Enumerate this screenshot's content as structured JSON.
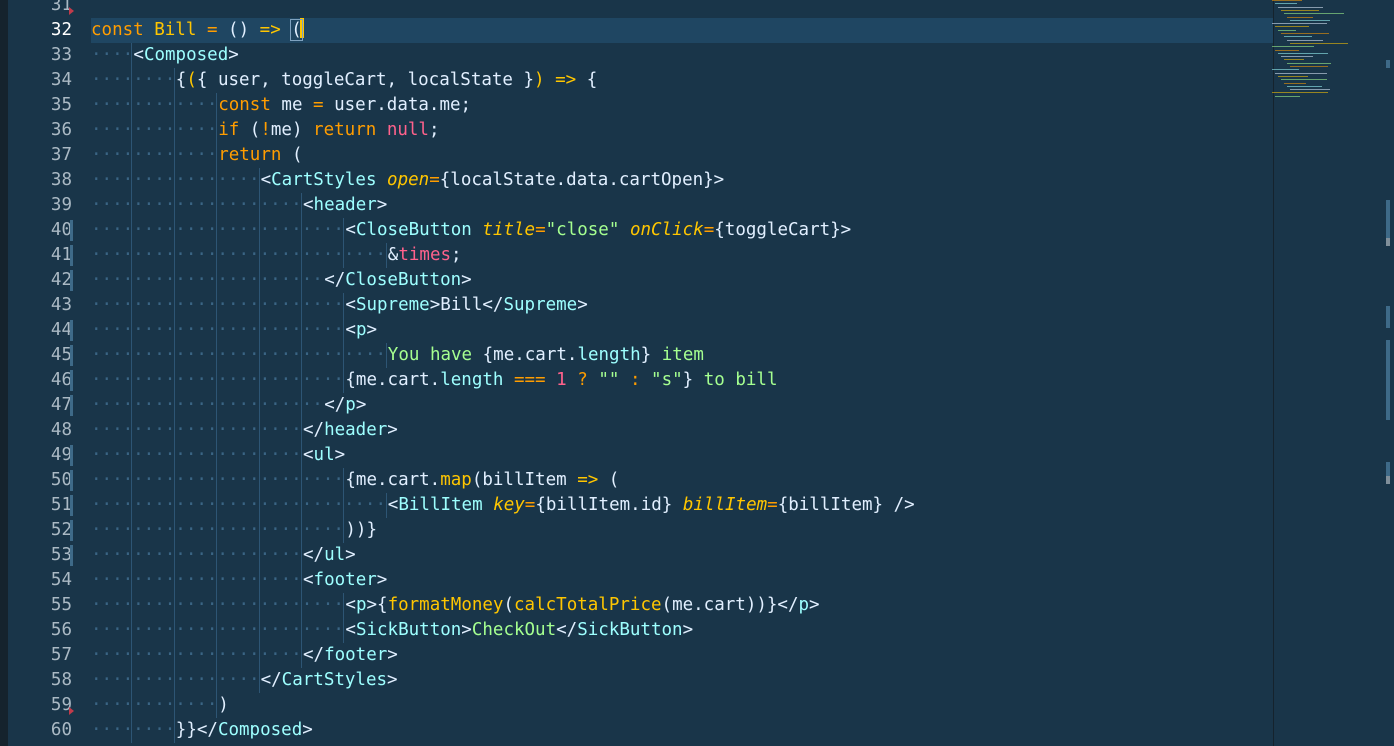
{
  "editor": {
    "theme_colors": {
      "background": "#193549",
      "active_line": "#1f4662",
      "line_number": "#aab9c4",
      "keyword": "#ff9d00",
      "constant": "#ffc600",
      "tag": "#9effff",
      "string": "#a5ff90",
      "number": "#ff628c",
      "attribute": "#ffc600",
      "text": "#e1efff"
    },
    "active_line": 32,
    "lines": [
      {
        "n": "31",
        "indent": 0,
        "parts": []
      },
      {
        "n": "32",
        "indent": 0,
        "parts": [
          {
            "t": "const",
            "c": "#ff9d00"
          },
          {
            "t": " "
          },
          {
            "t": "Bill",
            "c": "#ffc600"
          },
          {
            "t": " "
          },
          {
            "t": "=",
            "c": "#ff9d00"
          },
          {
            "t": " "
          },
          {
            "t": "()",
            "c": "#e1efff"
          },
          {
            "t": " "
          },
          {
            "t": "=>",
            "c": "#ffc600"
          },
          {
            "t": " "
          },
          {
            "t": "(",
            "c": "#e1efff",
            "caret": true
          }
        ]
      },
      {
        "n": "33",
        "indent": 4,
        "parts": [
          {
            "t": "<",
            "c": "#e1efff"
          },
          {
            "t": "Composed",
            "c": "#9effff"
          },
          {
            "t": ">",
            "c": "#e1efff"
          }
        ]
      },
      {
        "n": "34",
        "indent": 8,
        "parts": [
          {
            "t": "{",
            "c": "#e1efff"
          },
          {
            "t": "(",
            "c": "#ffc600"
          },
          {
            "t": "{ user, toggleCart, localState }",
            "c": "#e1efff"
          },
          {
            "t": ")",
            "c": "#ffc600"
          },
          {
            "t": " "
          },
          {
            "t": "=>",
            "c": "#ffc600"
          },
          {
            "t": " {",
            "c": "#e1efff"
          }
        ]
      },
      {
        "n": "35",
        "indent": 12,
        "parts": [
          {
            "t": "const",
            "c": "#ff9d00"
          },
          {
            "t": " me "
          },
          {
            "t": "=",
            "c": "#ff9d00"
          },
          {
            "t": " user.data.me;",
            "c": "#e1efff"
          }
        ]
      },
      {
        "n": "36",
        "indent": 12,
        "parts": [
          {
            "t": "if",
            "c": "#ff9d00"
          },
          {
            "t": " ("
          },
          {
            "t": "!",
            "c": "#ff9d00"
          },
          {
            "t": "me) "
          },
          {
            "t": "return",
            "c": "#ff9d00"
          },
          {
            "t": " "
          },
          {
            "t": "null",
            "c": "#ff628c"
          },
          {
            "t": ";"
          }
        ]
      },
      {
        "n": "37",
        "indent": 12,
        "parts": [
          {
            "t": "return",
            "c": "#ff9d00"
          },
          {
            "t": " ("
          }
        ]
      },
      {
        "n": "38",
        "indent": 16,
        "parts": [
          {
            "t": "<"
          },
          {
            "t": "CartStyles",
            "c": "#9effff"
          },
          {
            "t": " "
          },
          {
            "t": "open",
            "c": "#ffc600",
            "i": true
          },
          {
            "t": "=",
            "c": "#ff9d00"
          },
          {
            "t": "{localState.data.cartOpen}>"
          }
        ]
      },
      {
        "n": "39",
        "indent": 20,
        "parts": [
          {
            "t": "<"
          },
          {
            "t": "header",
            "c": "#9effff"
          },
          {
            "t": ">"
          }
        ]
      },
      {
        "n": "40",
        "indent": 24,
        "parts": [
          {
            "t": "<"
          },
          {
            "t": "CloseButton",
            "c": "#9effff"
          },
          {
            "t": " "
          },
          {
            "t": "title",
            "c": "#ffc600",
            "i": true
          },
          {
            "t": "=",
            "c": "#ff9d00"
          },
          {
            "t": "\"close\"",
            "c": "#a5ff90"
          },
          {
            "t": " "
          },
          {
            "t": "onClick",
            "c": "#ffc600",
            "i": true
          },
          {
            "t": "=",
            "c": "#ff9d00"
          },
          {
            "t": "{toggleCart}>"
          }
        ]
      },
      {
        "n": "41",
        "indent": 28,
        "parts": [
          {
            "t": "&"
          },
          {
            "t": "times",
            "c": "#ff628c"
          },
          {
            "t": ";"
          }
        ]
      },
      {
        "n": "42",
        "indent": 22,
        "parts": [
          {
            "t": "</"
          },
          {
            "t": "CloseButton",
            "c": "#9effff"
          },
          {
            "t": ">"
          }
        ]
      },
      {
        "n": "43",
        "indent": 24,
        "parts": [
          {
            "t": "<"
          },
          {
            "t": "Supreme",
            "c": "#9effff"
          },
          {
            "t": ">Bill</"
          },
          {
            "t": "Supreme",
            "c": "#9effff"
          },
          {
            "t": ">"
          }
        ]
      },
      {
        "n": "44",
        "indent": 24,
        "parts": [
          {
            "t": "<"
          },
          {
            "t": "p",
            "c": "#9effff"
          },
          {
            "t": ">"
          }
        ]
      },
      {
        "n": "45",
        "indent": 28,
        "parts": [
          {
            "t": "You have ",
            "c": "#a5ff90"
          },
          {
            "t": "{me.cart."
          },
          {
            "t": "length",
            "c": "#9effff"
          },
          {
            "t": "}"
          },
          {
            "t": " item",
            "c": "#a5ff90"
          }
        ]
      },
      {
        "n": "46",
        "indent": 24,
        "parts": [
          {
            "t": "{me.cart."
          },
          {
            "t": "length",
            "c": "#9effff"
          },
          {
            "t": " "
          },
          {
            "t": "===",
            "c": "#ff9d00"
          },
          {
            "t": " "
          },
          {
            "t": "1",
            "c": "#ff628c"
          },
          {
            "t": " "
          },
          {
            "t": "?",
            "c": "#ff9d00"
          },
          {
            "t": " "
          },
          {
            "t": "\"\"",
            "c": "#a5ff90"
          },
          {
            "t": " "
          },
          {
            "t": ":",
            "c": "#ff9d00"
          },
          {
            "t": " "
          },
          {
            "t": "\"s\"",
            "c": "#a5ff90"
          },
          {
            "t": "}"
          },
          {
            "t": " to bill",
            "c": "#a5ff90"
          }
        ]
      },
      {
        "n": "47",
        "indent": 22,
        "parts": [
          {
            "t": "</"
          },
          {
            "t": "p",
            "c": "#9effff"
          },
          {
            "t": ">"
          }
        ]
      },
      {
        "n": "48",
        "indent": 20,
        "parts": [
          {
            "t": "</"
          },
          {
            "t": "header",
            "c": "#9effff"
          },
          {
            "t": ">"
          }
        ]
      },
      {
        "n": "49",
        "indent": 20,
        "parts": [
          {
            "t": "<"
          },
          {
            "t": "ul",
            "c": "#9effff"
          },
          {
            "t": ">"
          }
        ]
      },
      {
        "n": "50",
        "indent": 24,
        "parts": [
          {
            "t": "{me.cart."
          },
          {
            "t": "map",
            "c": "#ffc600"
          },
          {
            "t": "(billItem "
          },
          {
            "t": "=>",
            "c": "#ffc600"
          },
          {
            "t": " ("
          }
        ]
      },
      {
        "n": "51",
        "indent": 28,
        "parts": [
          {
            "t": "<"
          },
          {
            "t": "BillItem",
            "c": "#9effff"
          },
          {
            "t": " "
          },
          {
            "t": "key",
            "c": "#ffc600",
            "i": true
          },
          {
            "t": "=",
            "c": "#ff9d00"
          },
          {
            "t": "{billItem.id} "
          },
          {
            "t": "billItem",
            "c": "#ffc600",
            "i": true
          },
          {
            "t": "=",
            "c": "#ff9d00"
          },
          {
            "t": "{billItem} />"
          }
        ]
      },
      {
        "n": "52",
        "indent": 24,
        "parts": [
          {
            "t": "))}"
          }
        ]
      },
      {
        "n": "53",
        "indent": 20,
        "parts": [
          {
            "t": "</"
          },
          {
            "t": "ul",
            "c": "#9effff"
          },
          {
            "t": ">"
          }
        ]
      },
      {
        "n": "54",
        "indent": 20,
        "parts": [
          {
            "t": "<"
          },
          {
            "t": "footer",
            "c": "#9effff"
          },
          {
            "t": ">"
          }
        ]
      },
      {
        "n": "55",
        "indent": 24,
        "parts": [
          {
            "t": "<"
          },
          {
            "t": "p",
            "c": "#9effff"
          },
          {
            "t": ">{"
          },
          {
            "t": "formatMoney",
            "c": "#ffc600"
          },
          {
            "t": "("
          },
          {
            "t": "calcTotalPrice",
            "c": "#ffc600"
          },
          {
            "t": "(me.cart))}</"
          },
          {
            "t": "p",
            "c": "#9effff"
          },
          {
            "t": ">"
          }
        ]
      },
      {
        "n": "56",
        "indent": 24,
        "parts": [
          {
            "t": "<"
          },
          {
            "t": "SickButton",
            "c": "#9effff"
          },
          {
            "t": ">"
          },
          {
            "t": "CheckOut",
            "c": "#a5ff90"
          },
          {
            "t": "</"
          },
          {
            "t": "SickButton",
            "c": "#9effff"
          },
          {
            "t": ">"
          }
        ]
      },
      {
        "n": "57",
        "indent": 20,
        "parts": [
          {
            "t": "</"
          },
          {
            "t": "footer",
            "c": "#9effff"
          },
          {
            "t": ">"
          }
        ]
      },
      {
        "n": "58",
        "indent": 16,
        "parts": [
          {
            "t": "</"
          },
          {
            "t": "CartStyles",
            "c": "#9effff"
          },
          {
            "t": ">"
          }
        ]
      },
      {
        "n": "59",
        "indent": 12,
        "parts": [
          {
            "t": ")"
          }
        ]
      },
      {
        "n": "60",
        "indent": 8,
        "parts": [
          {
            "t": "}}</"
          },
          {
            "t": "Composed",
            "c": "#9effff"
          },
          {
            "t": ">"
          }
        ]
      }
    ],
    "git_modified_lines": [
      "40",
      "41",
      "42",
      "44",
      "45",
      "46",
      "47",
      "49",
      "50",
      "51",
      "52",
      "53"
    ],
    "error_markers": [
      "31",
      "59"
    ]
  }
}
